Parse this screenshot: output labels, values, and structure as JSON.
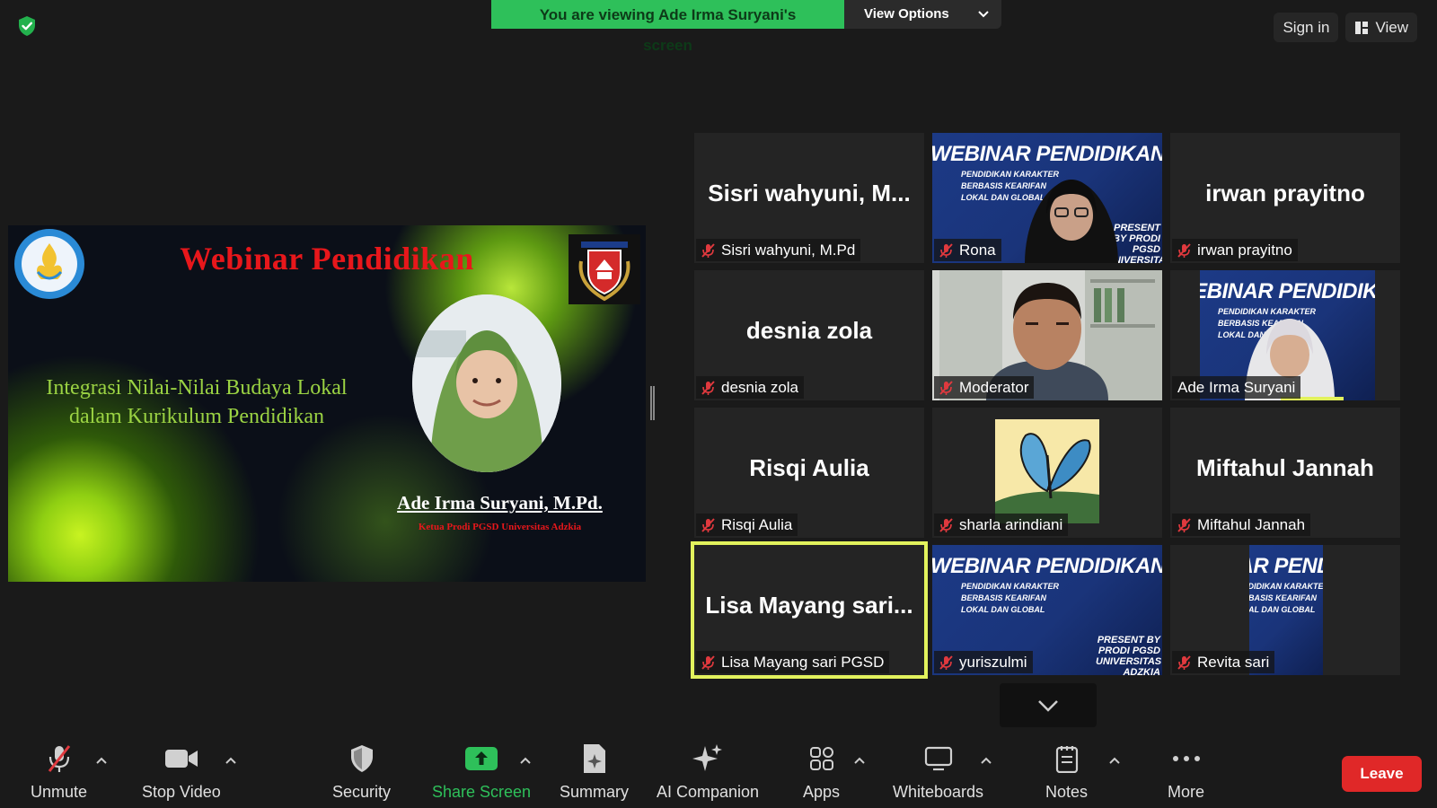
{
  "top": {
    "viewing_text": "You are viewing Ade Irma Suryani's screen",
    "view_options_label": "View Options",
    "sign_in_label": "Sign in",
    "view_label": "View"
  },
  "shared_slide": {
    "title": "Webinar Pendidikan",
    "topic": "Integrasi Nilai-Nilai Budaya Lokal dalam Kurikulum Pendidikan",
    "speaker_name": "Ade Irma Suryani, M.Pd.",
    "speaker_role": "Ketua Prodi PGSD Universitas Adzkia",
    "logo_left_text": "TUT WURI HANDAYANI",
    "logo_right_text": "UNIVERSITAS ADZKIA"
  },
  "webinar_bg": {
    "title": "WEBINAR PENDIDIKAN",
    "subtitle": "PENDIDIKAN KARAKTER BERBASIS KEARIFAN LOKAL DAN GLOBAL",
    "presenter": "PRESENT BY PRODI PGSD UNIVERSITAS ADZKIA"
  },
  "participants": [
    {
      "display": "Sisri wahyuni, M...",
      "name": "Sisri wahyuni, M.Pd",
      "muted": true,
      "type": "name"
    },
    {
      "display": "",
      "name": "Rona",
      "muted": true,
      "type": "webinar-person"
    },
    {
      "display": "irwan prayitno",
      "name": "irwan prayitno",
      "muted": true,
      "type": "name"
    },
    {
      "display": "desnia zola",
      "name": "desnia zola",
      "muted": true,
      "type": "name"
    },
    {
      "display": "",
      "name": "Moderator",
      "muted": true,
      "type": "camera"
    },
    {
      "display": "",
      "name": "Ade Irma Suryani",
      "muted": false,
      "type": "speaker-camera"
    },
    {
      "display": "Risqi Aulia",
      "name": "Risqi Aulia",
      "muted": true,
      "type": "name"
    },
    {
      "display": "",
      "name": "sharla arindiani",
      "muted": true,
      "type": "butterfly"
    },
    {
      "display": "Miftahul Jannah",
      "name": "Miftahul Jannah",
      "muted": true,
      "type": "name"
    },
    {
      "display": "Lisa Mayang sari...",
      "name": "Lisa Mayang sari PGSD",
      "muted": true,
      "type": "name-active"
    },
    {
      "display": "",
      "name": "yuriszulmi",
      "muted": true,
      "type": "webinar"
    },
    {
      "display": "",
      "name": "Revita sari",
      "muted": true,
      "type": "webinar-narrow"
    }
  ],
  "toolbar": {
    "unmute": "Unmute",
    "stop_video": "Stop Video",
    "security": "Security",
    "share_screen": "Share Screen",
    "summary": "Summary",
    "ai_companion": "AI Companion",
    "apps": "Apps",
    "whiteboards": "Whiteboards",
    "notes": "Notes",
    "more": "More",
    "leave": "Leave"
  },
  "colors": {
    "share_green": "#2ec05a",
    "leave_red": "#e02828",
    "active_speaker_outline": "#e2f25d",
    "muted_red": "#e0393e"
  }
}
